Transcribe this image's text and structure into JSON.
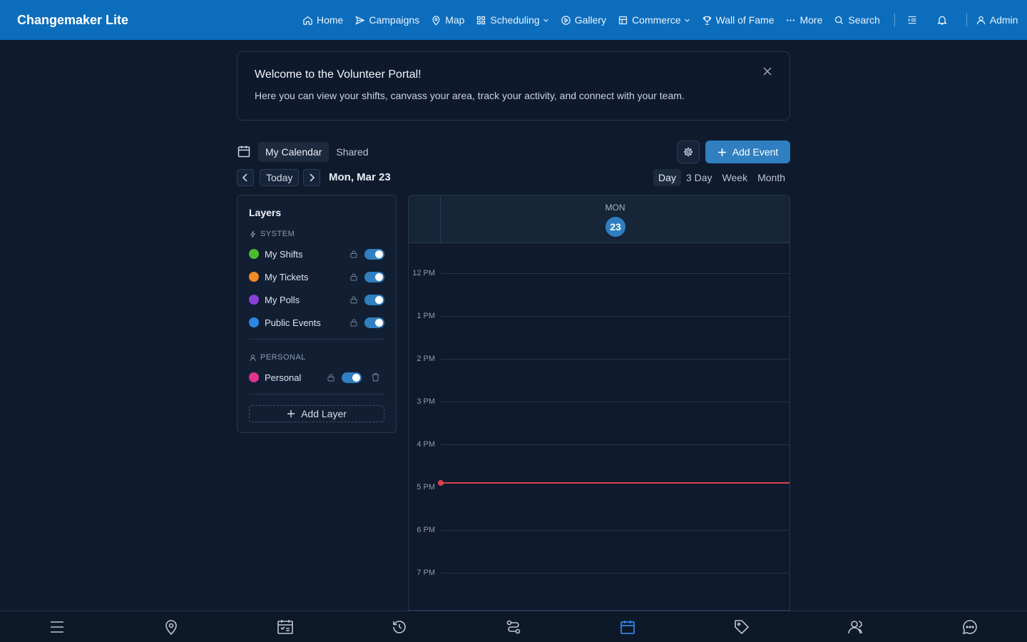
{
  "app": {
    "title": "Changemaker Lite"
  },
  "nav": {
    "items": [
      {
        "label": "Home",
        "icon": "home-icon"
      },
      {
        "label": "Campaigns",
        "icon": "send-icon"
      },
      {
        "label": "Map",
        "icon": "map-pin-icon"
      },
      {
        "label": "Scheduling",
        "icon": "grid-icon",
        "dropdown": true
      },
      {
        "label": "Gallery",
        "icon": "play-circle-icon"
      },
      {
        "label": "Commerce",
        "icon": "store-icon",
        "dropdown": true
      },
      {
        "label": "Wall of Fame",
        "icon": "trophy-icon"
      },
      {
        "label": "More",
        "icon": "ellipsis-icon"
      },
      {
        "label": "Search",
        "icon": "search-icon"
      }
    ],
    "user_label": "Admin"
  },
  "welcome": {
    "title": "Welcome to the Volunteer Portal!",
    "body": "Here you can view your shifts, canvass your area, track your activity, and connect with your team."
  },
  "calendar": {
    "tabs": [
      "My Calendar",
      "Shared"
    ],
    "active_tab": "My Calendar",
    "add_event_label": "Add Event",
    "today_label": "Today",
    "current_date": "Mon, Mar 23",
    "views": [
      "Day",
      "3 Day",
      "Week",
      "Month"
    ],
    "active_view": "Day",
    "day_of_week": "MON",
    "day_number": "23",
    "hours": [
      "12 PM",
      "1 PM",
      "2 PM",
      "3 PM",
      "4 PM",
      "5 PM",
      "6 PM",
      "7 PM"
    ],
    "now_indicator_color": "#d9434a"
  },
  "layers": {
    "title": "Layers",
    "system_label": "SYSTEM",
    "system": [
      {
        "name": "My Shifts",
        "color": "#4cbb2f",
        "enabled": true,
        "locked": true
      },
      {
        "name": "My Tickets",
        "color": "#f08a24",
        "enabled": true,
        "locked": true
      },
      {
        "name": "My Polls",
        "color": "#8b3fd9",
        "enabled": true,
        "locked": true
      },
      {
        "name": "Public Events",
        "color": "#2f86e6",
        "enabled": true,
        "locked": true
      }
    ],
    "personal_label": "PERSONAL",
    "personal": [
      {
        "name": "Personal",
        "color": "#e0338f",
        "enabled": true,
        "locked": true
      }
    ],
    "add_layer_label": "Add Layer"
  },
  "bottom_nav": {
    "items": [
      "menu-icon",
      "map-pin-icon",
      "calendar-check-icon",
      "history-icon",
      "route-icon",
      "calendar-icon",
      "tag-icon",
      "users-icon",
      "chat-icon"
    ],
    "active": "calendar-icon"
  },
  "colors": {
    "accent": "#2f7fc1",
    "topbar": "#0c6dbd",
    "background": "#0f1b2d"
  }
}
